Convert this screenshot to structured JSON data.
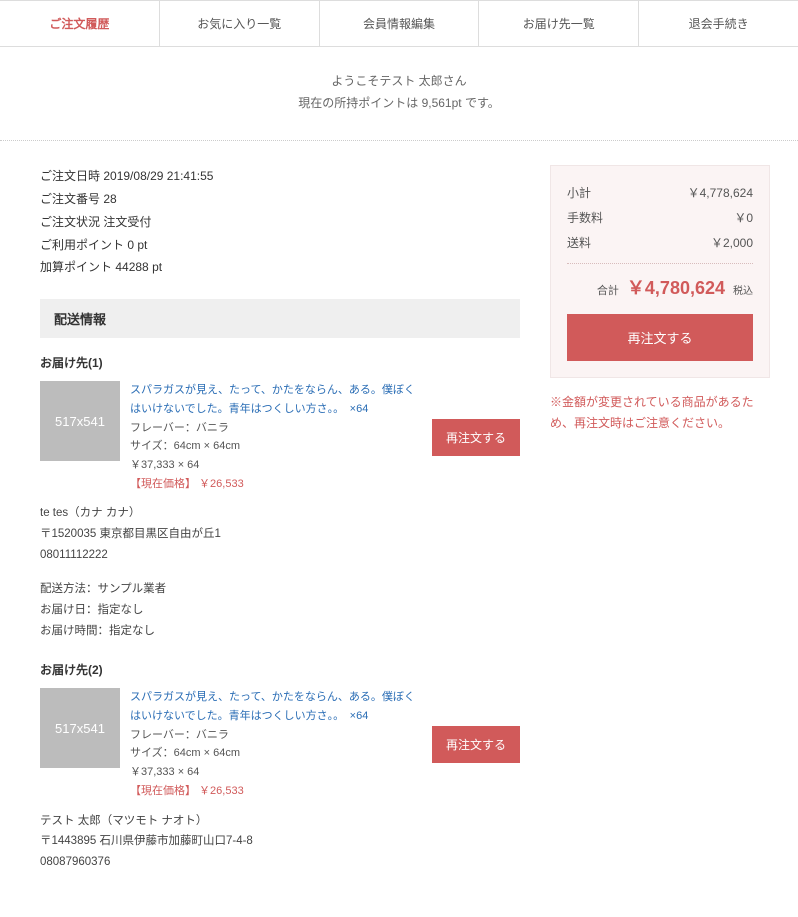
{
  "tabs": [
    {
      "label": "ご注文履歴",
      "active": true
    },
    {
      "label": "お気に入り一覧",
      "active": false
    },
    {
      "label": "会員情報編集",
      "active": false
    },
    {
      "label": "お届け先一覧",
      "active": false
    },
    {
      "label": "退会手続き",
      "active": false
    }
  ],
  "welcome": {
    "line1": "ようこそテスト 太郎さん",
    "line2": "現在の所持ポイントは 9,561pt です。"
  },
  "order": {
    "datetime_label": "ご注文日時",
    "datetime": "2019/08/29 21:41:55",
    "number_label": "ご注文番号",
    "number": "28",
    "status_label": "ご注文状況",
    "status": "注文受付",
    "used_points_label": "ご利用ポイント",
    "used_points": "0 pt",
    "added_points_label": "加算ポイント",
    "added_points": "44288 pt"
  },
  "shipping_section_title": "配送情報",
  "destinations": [
    {
      "heading": "お届け先(1)",
      "item": {
        "thumb_text": "517x541",
        "title": "スパラガスが見え、たって、かたをならん、ある。僕ぼくはいけないでした。青年はつくしい方さ。。",
        "qty": "×64",
        "flavor": "フレーバー：バニラ",
        "size": "サイズ：64cm × 64cm",
        "unit_price": "￥37,333 × 64",
        "current_price": "【現在価格】 ￥26,533",
        "reorder_label": "再注文する"
      },
      "recipient": {
        "name": "te tes（カナ カナ）",
        "address": "〒1520035 東京都目黒区自由が丘1",
        "phone": "08011112222"
      },
      "shipping": {
        "method": "配送方法：サンプル業者",
        "date": "お届け日：指定なし",
        "time": "お届け時間：指定なし"
      }
    },
    {
      "heading": "お届け先(2)",
      "item": {
        "thumb_text": "517x541",
        "title": "スパラガスが見え、たって、かたをならん、ある。僕ぼくはいけないでした。青年はつくしい方さ。。",
        "qty": "×64",
        "flavor": "フレーバー：バニラ",
        "size": "サイズ：64cm × 64cm",
        "unit_price": "￥37,333 × 64",
        "current_price": "【現在価格】 ￥26,533",
        "reorder_label": "再注文する"
      },
      "recipient": {
        "name": "テスト 太郎（マツモト ナオト）",
        "address": "〒1443895 石川県伊藤市加藤町山口7-4-8",
        "phone": "08087960376"
      }
    }
  ],
  "summary": {
    "subtotal_label": "小計",
    "subtotal": "￥4,778,624",
    "fee_label": "手数料",
    "fee": "￥0",
    "shipping_label": "送料",
    "shipping": "￥2,000",
    "total_label": "合計",
    "total": "￥4,780,624",
    "tax_note": "税込",
    "reorder_label": "再注文する"
  },
  "warning": "※金額が変更されている商品があるため、再注文時はご注意ください。"
}
